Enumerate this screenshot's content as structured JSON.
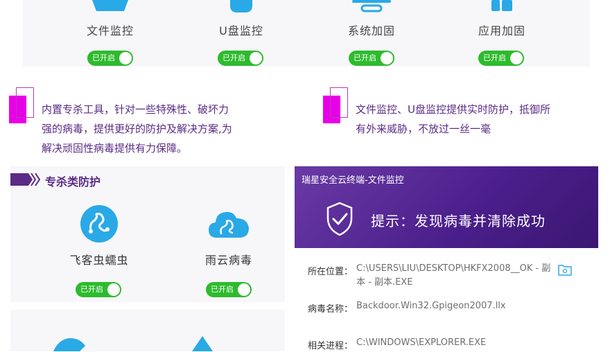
{
  "monitor_items": [
    {
      "label": "文件监控",
      "toggle": "已开启",
      "icon": "file-monitor-icon"
    },
    {
      "label": "U盘监控",
      "toggle": "已开启",
      "icon": "usb-monitor-icon"
    },
    {
      "label": "系统加固",
      "toggle": "已开启",
      "icon": "system-harden-icon"
    },
    {
      "label": "应用加固",
      "toggle": "已开启",
      "icon": "app-harden-icon"
    }
  ],
  "callouts": [
    {
      "lines": [
        "内置专杀工具，针对一些特殊性、破坏力",
        "强的病毒，提供更好的防护及解决方案,为",
        "解决顽固性病毒提供有力保障。"
      ]
    },
    {
      "lines": [
        "文件监控、U盘监控提供实时防护，抵御所",
        "有外来威胁，不放过一丝一毫"
      ]
    }
  ],
  "special_kill": {
    "title": "专杀类防护",
    "items": [
      {
        "label": "飞客虫蠕虫",
        "toggle": "已开启",
        "icon": "worm-icon"
      },
      {
        "label": "雨云病毒",
        "toggle": "已开启",
        "icon": "cloud-virus-icon"
      }
    ]
  },
  "alert_window": {
    "title": "瑞星安全云终端-文件监控",
    "message": "提示：发现病毒并清除成功",
    "rows": [
      {
        "label": "所在位置：",
        "value": "C:\\USERS\\LIU\\DESKTOP\\HKFX2008__OK - 副本 - 副本.EXE"
      },
      {
        "label": "病毒名称：",
        "value": "Backdoor.Win32.Gpigeon2007.llx"
      },
      {
        "label": "相关进程：",
        "value": "C:\\WINDOWS\\EXPLORER.EXE"
      }
    ]
  },
  "colors": {
    "accent_purple": "#5b2b86",
    "toggle_green": "#2dbb2d",
    "magenta": "#e800e8",
    "icon_blue": "#29a9e6"
  }
}
